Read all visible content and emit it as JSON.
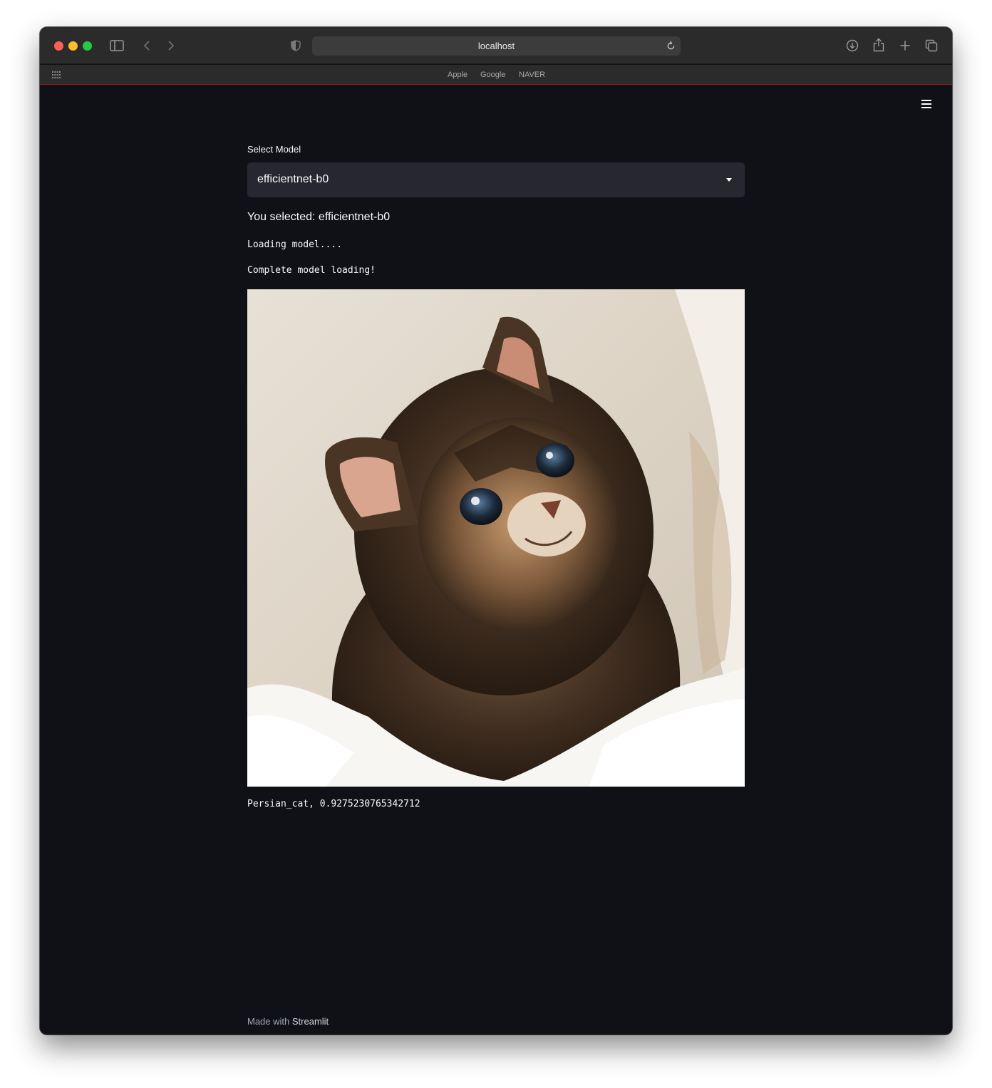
{
  "browser": {
    "address": "localhost",
    "bookmarks": [
      "Apple",
      "Google",
      "NAVER"
    ]
  },
  "app": {
    "select_label": "Select Model",
    "select_value": "efficientnet-b0",
    "selected_text": "You selected: efficientnet-b0",
    "loading_text": "Loading model....",
    "complete_text": "Complete model loading!",
    "prediction": "Persian_cat, 0.9275230765342712",
    "footer_prefix": "Made with",
    "footer_brand": "Streamlit"
  },
  "icons": {
    "sidebar": "sidebar-icon",
    "back": "chevron-left-icon",
    "forward": "chevron-right-icon",
    "shield": "shield-icon",
    "reload": "reload-icon",
    "download": "download-icon",
    "share": "share-icon",
    "new_tab": "plus-icon",
    "tabs": "tabs-overview-icon",
    "grid": "grid-icon",
    "menu": "hamburger-menu-icon"
  },
  "colors": {
    "background": "#0f1116",
    "select_bg": "#262730",
    "text": "#fafafa"
  }
}
